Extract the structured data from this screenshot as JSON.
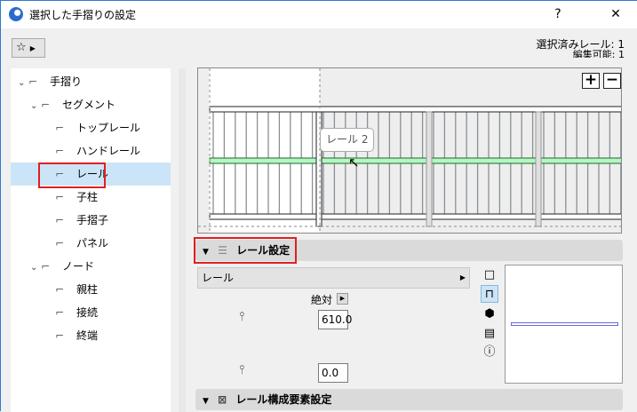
{
  "window": {
    "title": "選択した手摺りの設定",
    "help": "?",
    "close": "✕"
  },
  "favorites": {
    "label": "☆"
  },
  "status": {
    "selected": "選択済みレール: 1",
    "editable": "編集可能: 1"
  },
  "tree": [
    {
      "label": "手摺り",
      "level": 0,
      "expanded": true,
      "icon": "railing-icon"
    },
    {
      "label": "セグメント",
      "level": 1,
      "expanded": true,
      "icon": "segment-icon"
    },
    {
      "label": "トップレール",
      "level": 2,
      "icon": "top-rail-icon"
    },
    {
      "label": "ハンドレール",
      "level": 2,
      "icon": "handrail-icon"
    },
    {
      "label": "レール",
      "level": 2,
      "icon": "rail-icon",
      "selected": true
    },
    {
      "label": "子柱",
      "level": 2,
      "icon": "inner-post-icon"
    },
    {
      "label": "手摺子",
      "level": 2,
      "icon": "baluster-icon"
    },
    {
      "label": "パネル",
      "level": 2,
      "icon": "panel-icon"
    },
    {
      "label": "ノード",
      "level": 1,
      "expanded": true,
      "icon": "node-icon"
    },
    {
      "label": "親柱",
      "level": 2,
      "icon": "post-icon"
    },
    {
      "label": "接続",
      "level": 2,
      "icon": "connection-icon"
    },
    {
      "label": "終端",
      "level": 2,
      "icon": "end-icon"
    }
  ],
  "preview": {
    "zoom_in": "+",
    "zoom_out": "−",
    "tooltip": "レール 2",
    "highlight_color": "#b6f5c4"
  },
  "rail_settings": {
    "title": "レール設定",
    "dropdown": "レール",
    "reference": "絶対",
    "height": "610.0",
    "offset": "0.0"
  },
  "components": {
    "title": "レール構成要素設定"
  }
}
